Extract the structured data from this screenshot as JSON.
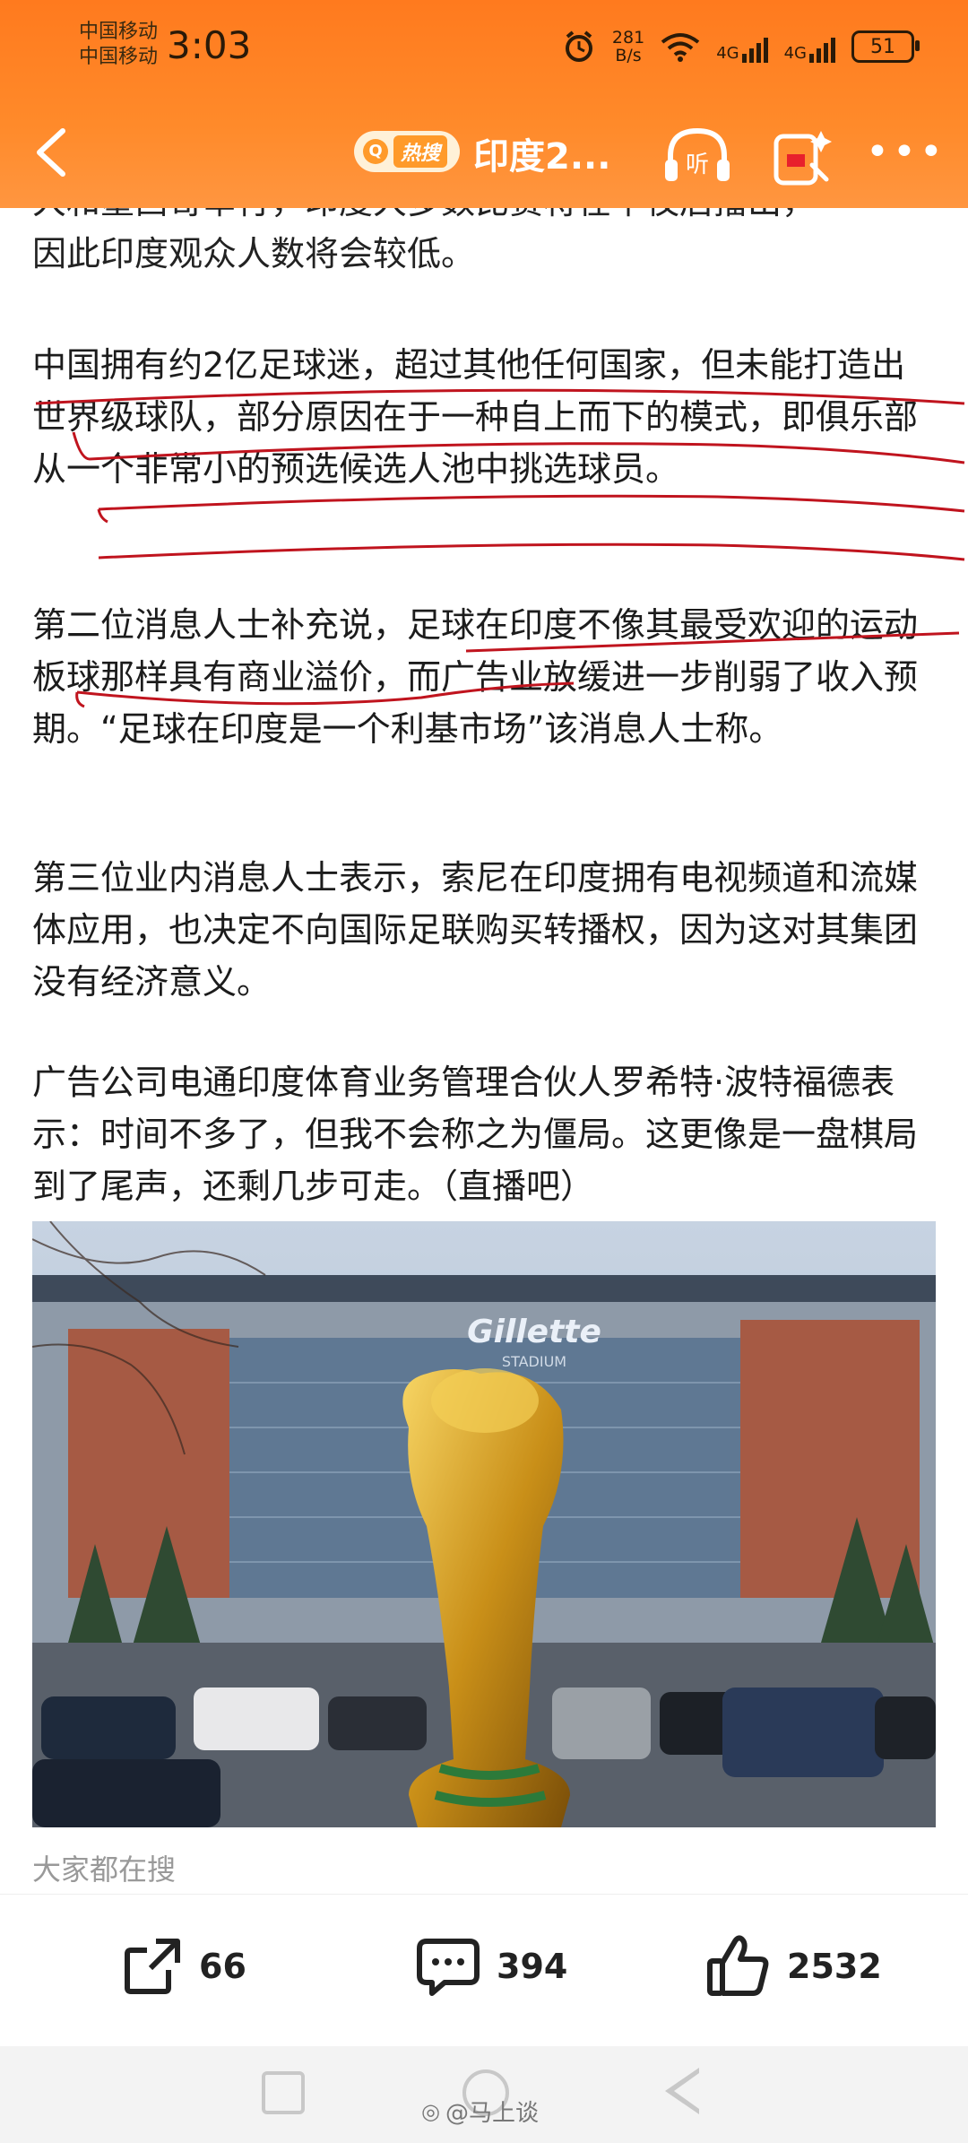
{
  "status_bar": {
    "carrier_1": "中国移动",
    "carrier_2": "中国移动",
    "time": "3:03",
    "net_speed_value": "281",
    "net_speed_unit": "B/s",
    "network_1": "4G",
    "network_2": "4G",
    "battery": "51"
  },
  "nav": {
    "hot_badge": "热搜",
    "title": "印度2...",
    "listen_label": "听"
  },
  "article": {
    "cut_line_1": "大和墨西哥举行，印度大多数比赛将在午夜后播出，",
    "cut_line_2": "因此印度观众人数将会较低。",
    "p1": "中国拥有约2亿足球迷，超过其他任何国家，但未能打造出世界级球队，部分原因在于一种自上而下的模式，即俱乐部从一个非常小的预选候选人池中挑选球员。",
    "p2": "第二位消息人士补充说，足球在印度不像其最受欢迎的运动板球那样具有商业溢价，而广告业放缓进一步削弱了收入预期。“足球在印度是一个利基市场”该消息人士称。",
    "p3": "第三位业内消息人士表示，索尼在印度拥有电视频道和流媒体应用，也决定不向国际足联购买转播权，因为这对其集团没有经济意义。",
    "p4": "广告公司电通印度体育业务管理合伙人罗希特·波特福德表示：时间不多了，但我不会称之为僵局。这更像是一盘棋局到了尾声，还剩几步可走。（直播吧）",
    "photo_sign_1": "Gillette",
    "photo_sign_2": "STADIUM",
    "search_hint": "大家都在搜"
  },
  "actions": {
    "share_count": "66",
    "comment_count": "394",
    "like_count": "2532"
  },
  "watermark": "@马上谈",
  "colors": {
    "header_orange": "#ff7a1e",
    "annotation_red": "#c0141e"
  }
}
